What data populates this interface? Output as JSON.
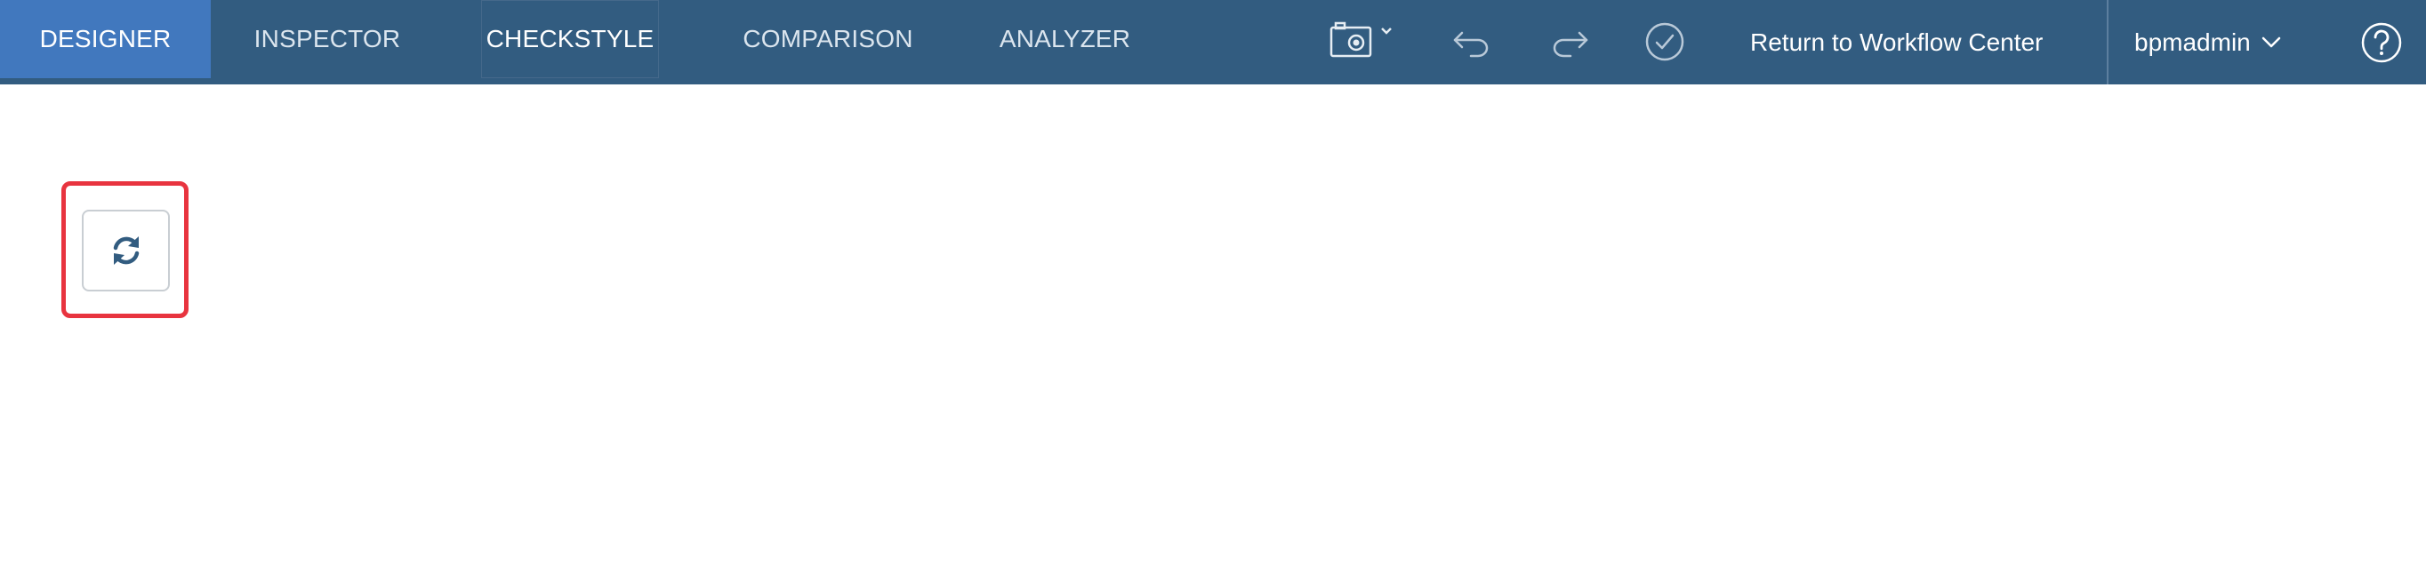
{
  "nav": {
    "tabs": [
      {
        "label": "DESIGNER"
      },
      {
        "label": "INSPECTOR"
      },
      {
        "label": "CHECKSTYLE"
      },
      {
        "label": "COMPARISON"
      },
      {
        "label": "ANALYZER"
      }
    ],
    "active_tab": "DESIGNER"
  },
  "toolbar": {
    "snapshot_icon": "camera-icon",
    "undo_icon": "undo-arrow-icon",
    "redo_icon": "redo-arrow-icon",
    "validate_icon": "check-circle-icon",
    "return_link": "Return to Workflow Center",
    "username": "bpmadmin",
    "help_icon": "question-circle-icon"
  },
  "main": {
    "refresh_icon": "refresh-icon"
  },
  "colors": {
    "topbar": "#325c80",
    "active_tab": "#4178be",
    "highlight": "#e8343f",
    "icon": "#325c80"
  }
}
